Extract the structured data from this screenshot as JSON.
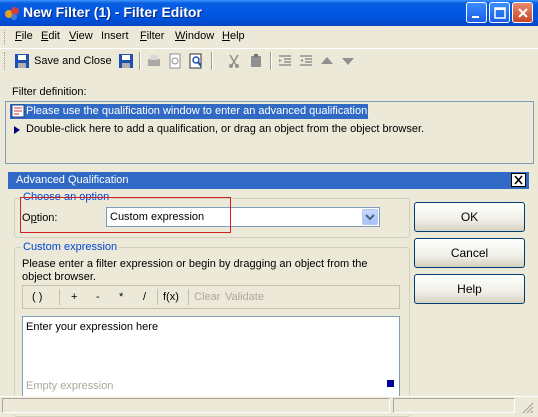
{
  "window": {
    "title": "New Filter (1) - Filter Editor"
  },
  "menubar": {
    "items": [
      {
        "label": "File",
        "key": "F",
        "rest": "ile"
      },
      {
        "label": "Edit",
        "key": "E",
        "rest": "dit"
      },
      {
        "label": "View",
        "key": "V",
        "rest": "iew"
      },
      {
        "label": "Insert",
        "key": "",
        "rest": "Insert"
      },
      {
        "label": "Filter",
        "key": "F",
        "rest": "ilter"
      },
      {
        "label": "Window",
        "key": "W",
        "rest": "indow"
      },
      {
        "label": "Help",
        "key": "H",
        "rest": "elp"
      }
    ]
  },
  "toolbar": {
    "save_close_label": "Save and Close"
  },
  "filter_definition": {
    "label": "Filter definition:",
    "rows": [
      "Please use the qualification window to enter an advanced qualification.",
      "Double-click here to add a qualification, or drag an object from the object browser."
    ]
  },
  "advanced": {
    "header": "Advanced Qualification",
    "choose_title": "Choose an option",
    "option_label": "Option:",
    "option_key": "p",
    "option_value": "Custom expression",
    "custom_title": "Custom expression",
    "custom_help": "Please enter a filter expression or begin by dragging an object from the object browser.",
    "expr_buttons": [
      "( )",
      "+",
      "-",
      "*",
      "/",
      "f(x)"
    ],
    "clear_label": "Clear",
    "validate_label": "Validate",
    "placeholder": "Enter your expression here",
    "status": "Empty expression",
    "ok_label": "OK",
    "cancel_label": "Cancel",
    "help_label": "Help"
  },
  "colors": {
    "titlebar": "#0058e6",
    "selection": "#316ac5",
    "annotation": "#d02020"
  }
}
